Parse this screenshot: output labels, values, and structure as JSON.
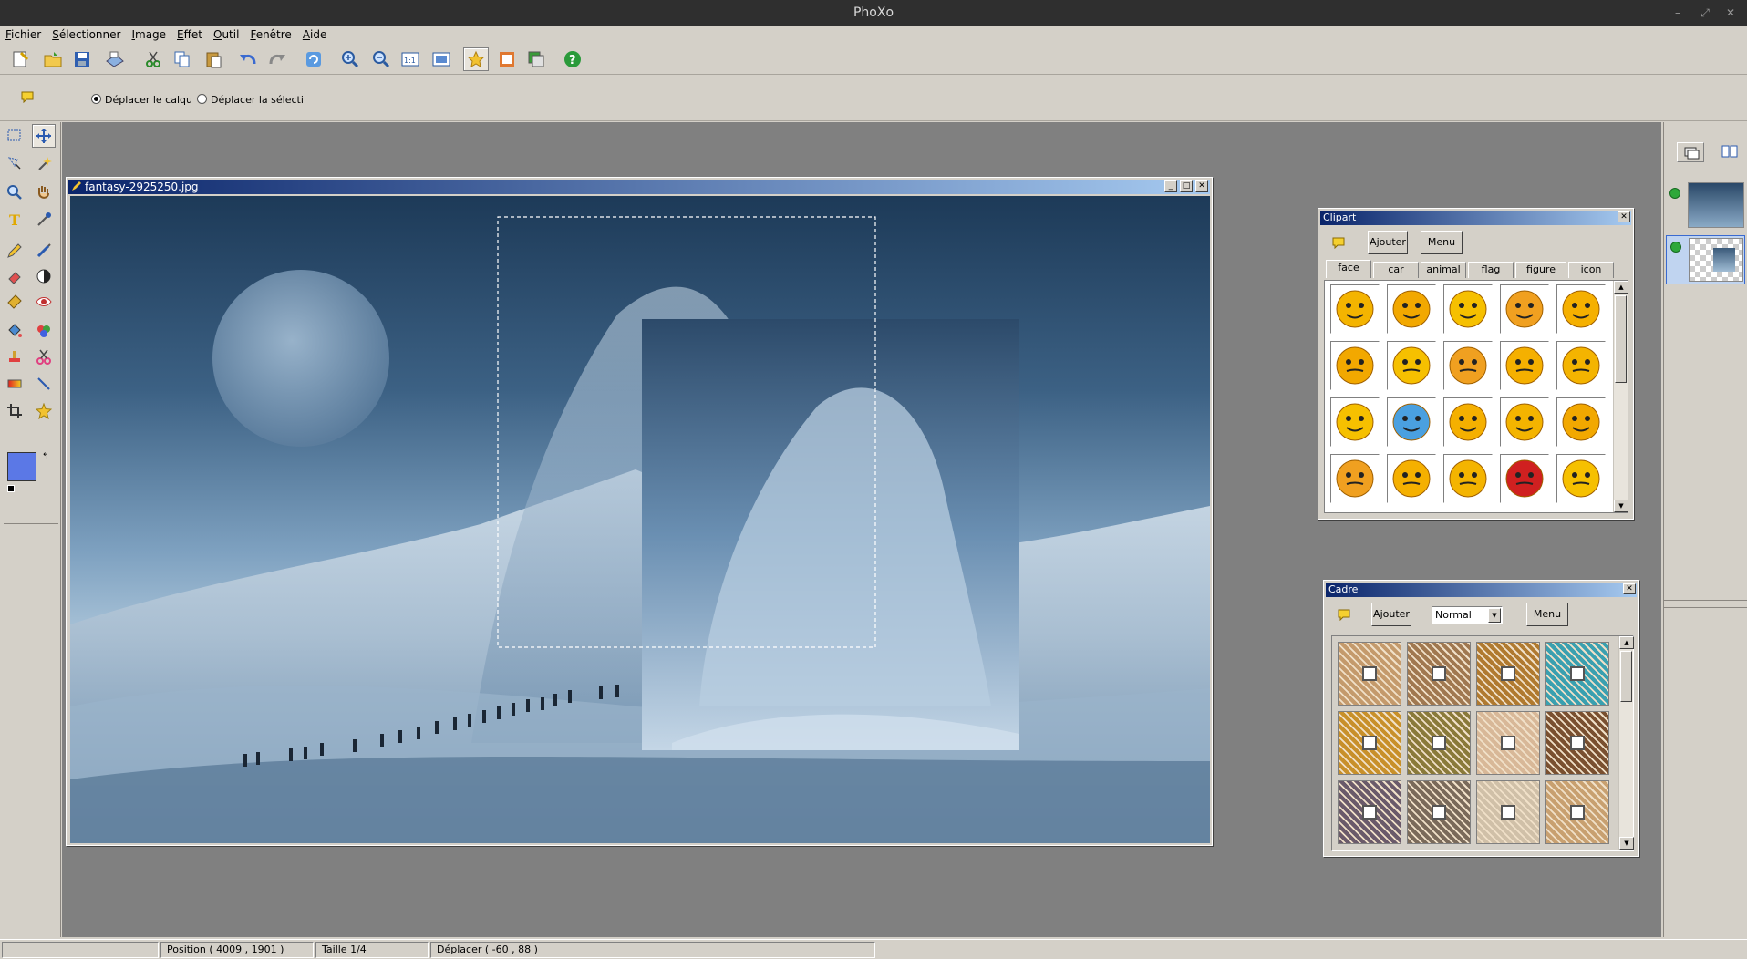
{
  "app": {
    "title": "PhoXo"
  },
  "menu": [
    "Fichier",
    "Sélectionner",
    "Image",
    "Effet",
    "Outil",
    "Fenêtre",
    "Aide"
  ],
  "options": {
    "move_layer": "Déplacer le calqu",
    "move_selection": "Déplacer la sélecti"
  },
  "document": {
    "title": "fantasy-2925250.jpg"
  },
  "clipart": {
    "title": "Clipart",
    "add_label": "Ajouter",
    "menu_label": "Menu",
    "tabs": [
      "face",
      "car",
      "animal",
      "flag",
      "figure",
      "icon"
    ],
    "selected_tab": "face"
  },
  "cadre": {
    "title": "Cadre",
    "add_label": "Ajouter",
    "menu_label": "Menu",
    "mode": "Normal"
  },
  "status": {
    "position": "Position ( 4009 , 1901 )",
    "size": "Taille 1/4",
    "move": "Déplacer ( -60 , 88 )"
  },
  "colors": {
    "foreground": "#5b78e6",
    "background": "#ffffff",
    "accent": "#0a246a"
  }
}
